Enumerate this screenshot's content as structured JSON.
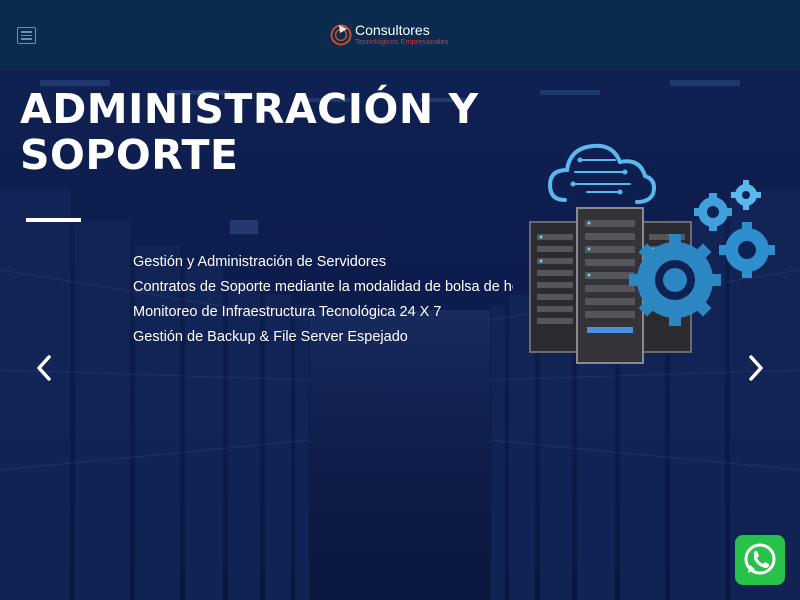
{
  "header": {
    "brand_name": "Consultores",
    "brand_tagline": "Tecnológicos Empresariales",
    "menu_icon": "hamburger-menu-icon"
  },
  "slide": {
    "title_line_1": "ADMINISTRACIÓN Y",
    "title_line_2": "SOPORTE",
    "services": [
      "Gestión y Administración de Servidores",
      "Contratos de Soporte mediante la modalidad de bolsa de horas",
      "Monitoreo de Infraestructura Tecnológica 24 X 7",
      "Gestión de Backup & File Server Espejado"
    ],
    "prev_icon": "chevron-left-icon",
    "next_icon": "chevron-right-icon"
  },
  "whatsapp": {
    "icon": "whatsapp-icon"
  },
  "colors": {
    "header_bg": "#0a2b4e",
    "hero_bg": "#0f2052",
    "accent_cyan": "#5ab8ee",
    "gear_blue": "#2b86c2",
    "whatsapp_green": "#28c14a"
  }
}
